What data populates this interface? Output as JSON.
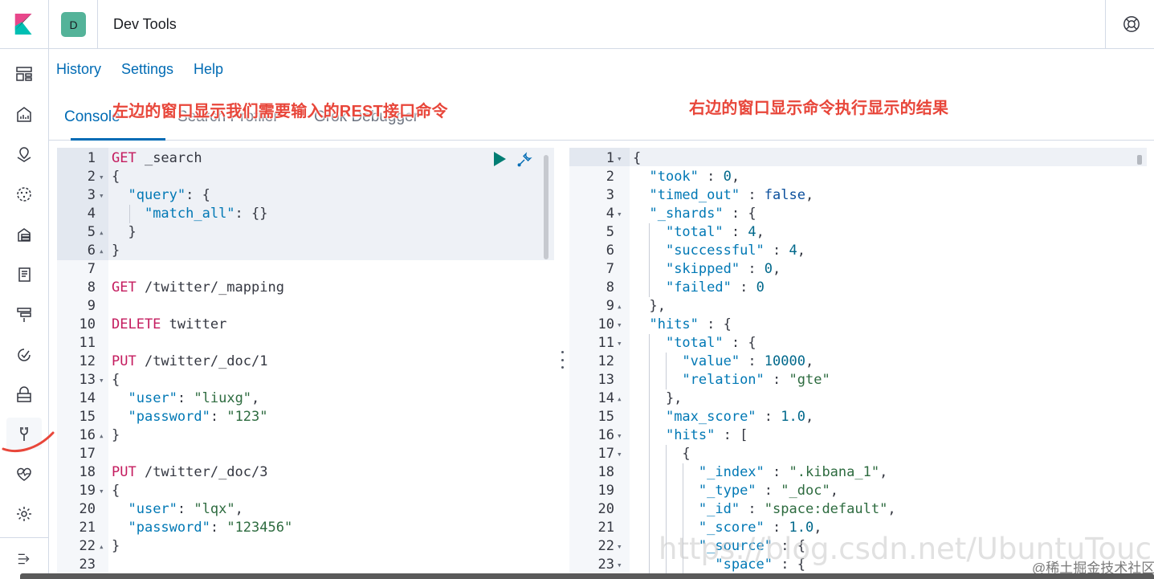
{
  "header": {
    "space_initial": "D",
    "app_title": "Dev Tools"
  },
  "leftnav": {
    "items": [
      {
        "icon": "discover-icon"
      },
      {
        "icon": "visualize-icon"
      },
      {
        "icon": "maps-icon"
      },
      {
        "icon": "ml-icon"
      },
      {
        "icon": "infrastructure-icon"
      },
      {
        "icon": "logs-icon"
      },
      {
        "icon": "apm-icon"
      },
      {
        "icon": "uptime-icon"
      },
      {
        "icon": "siem-icon"
      },
      {
        "icon": "dev-tools-icon",
        "active": true
      },
      {
        "icon": "monitoring-icon"
      },
      {
        "icon": "management-icon"
      }
    ],
    "collapse_icon": "collapse-menu-icon"
  },
  "topmenu": {
    "history": "History",
    "settings": "Settings",
    "help": "Help"
  },
  "tabs": {
    "console": "Console",
    "search_profiler": "Search Profiler",
    "grok_debugger": "Grok Debugger"
  },
  "annotations": {
    "left": "左边的窗口显示我们需要输入的REST接口命令",
    "right": "右边的窗口显示命令执行显示的结果"
  },
  "request_editor": {
    "lines": [
      {
        "n": "1",
        "fold": "",
        "tokens": [
          [
            "m",
            "GET"
          ],
          [
            "u",
            " _search"
          ]
        ]
      },
      {
        "n": "2",
        "fold": "▾",
        "tokens": [
          [
            "u",
            "{"
          ]
        ]
      },
      {
        "n": "3",
        "fold": "▾",
        "tokens": [
          [
            "u",
            "  "
          ],
          [
            "k",
            "\"query\""
          ],
          [
            "u",
            ": {"
          ]
        ]
      },
      {
        "n": "4",
        "fold": "",
        "tokens": [
          [
            "u",
            "    "
          ],
          [
            "k",
            "\"match_all\""
          ],
          [
            "u",
            ": {}"
          ]
        ]
      },
      {
        "n": "5",
        "fold": "▴",
        "tokens": [
          [
            "u",
            "  }"
          ]
        ]
      },
      {
        "n": "6",
        "fold": "▴",
        "tokens": [
          [
            "u",
            "}"
          ]
        ]
      },
      {
        "n": "7",
        "fold": "",
        "tokens": []
      },
      {
        "n": "8",
        "fold": "",
        "tokens": [
          [
            "m",
            "GET"
          ],
          [
            "u",
            " /twitter/_mapping"
          ]
        ]
      },
      {
        "n": "9",
        "fold": "",
        "tokens": []
      },
      {
        "n": "10",
        "fold": "",
        "tokens": [
          [
            "m",
            "DELETE"
          ],
          [
            "u",
            " twitter"
          ]
        ]
      },
      {
        "n": "11",
        "fold": "",
        "tokens": []
      },
      {
        "n": "12",
        "fold": "",
        "tokens": [
          [
            "m",
            "PUT"
          ],
          [
            "u",
            " /twitter/_doc/1"
          ]
        ]
      },
      {
        "n": "13",
        "fold": "▾",
        "tokens": [
          [
            "u",
            "{"
          ]
        ]
      },
      {
        "n": "14",
        "fold": "",
        "tokens": [
          [
            "u",
            "  "
          ],
          [
            "k",
            "\"user\""
          ],
          [
            "u",
            ": "
          ],
          [
            "s",
            "\"liuxg\""
          ],
          [
            "u",
            ","
          ]
        ]
      },
      {
        "n": "15",
        "fold": "",
        "tokens": [
          [
            "u",
            "  "
          ],
          [
            "k",
            "\"password\""
          ],
          [
            "u",
            ": "
          ],
          [
            "s",
            "\"123\""
          ]
        ]
      },
      {
        "n": "16",
        "fold": "▴",
        "tokens": [
          [
            "u",
            "}"
          ]
        ]
      },
      {
        "n": "17",
        "fold": "",
        "tokens": []
      },
      {
        "n": "18",
        "fold": "",
        "tokens": [
          [
            "m",
            "PUT"
          ],
          [
            "u",
            " /twitter/_doc/3"
          ]
        ]
      },
      {
        "n": "19",
        "fold": "▾",
        "tokens": [
          [
            "u",
            "{"
          ]
        ]
      },
      {
        "n": "20",
        "fold": "",
        "tokens": [
          [
            "u",
            "  "
          ],
          [
            "k",
            "\"user\""
          ],
          [
            "u",
            ": "
          ],
          [
            "s",
            "\"lqx\""
          ],
          [
            "u",
            ","
          ]
        ]
      },
      {
        "n": "21",
        "fold": "",
        "tokens": [
          [
            "u",
            "  "
          ],
          [
            "k",
            "\"password\""
          ],
          [
            "u",
            ": "
          ],
          [
            "s",
            "\"123456\""
          ]
        ]
      },
      {
        "n": "22",
        "fold": "▴",
        "tokens": [
          [
            "u",
            "}"
          ]
        ]
      },
      {
        "n": "23",
        "fold": "",
        "tokens": []
      }
    ]
  },
  "response_editor": {
    "lines": [
      {
        "n": "1",
        "fold": "▾",
        "tokens": [
          [
            "u",
            "{"
          ]
        ]
      },
      {
        "n": "2",
        "fold": "",
        "tokens": [
          [
            "u",
            "  "
          ],
          [
            "k",
            "\"took\""
          ],
          [
            "u",
            " : "
          ],
          [
            "i",
            "0"
          ],
          [
            "u",
            ","
          ]
        ]
      },
      {
        "n": "3",
        "fold": "",
        "tokens": [
          [
            "u",
            "  "
          ],
          [
            "k",
            "\"timed_out\""
          ],
          [
            "u",
            " : "
          ],
          [
            "b",
            "false"
          ],
          [
            "u",
            ","
          ]
        ]
      },
      {
        "n": "4",
        "fold": "▾",
        "tokens": [
          [
            "u",
            "  "
          ],
          [
            "k",
            "\"_shards\""
          ],
          [
            "u",
            " : {"
          ]
        ]
      },
      {
        "n": "5",
        "fold": "",
        "tokens": [
          [
            "u",
            "    "
          ],
          [
            "k",
            "\"total\""
          ],
          [
            "u",
            " : "
          ],
          [
            "i",
            "4"
          ],
          [
            "u",
            ","
          ]
        ]
      },
      {
        "n": "6",
        "fold": "",
        "tokens": [
          [
            "u",
            "    "
          ],
          [
            "k",
            "\"successful\""
          ],
          [
            "u",
            " : "
          ],
          [
            "i",
            "4"
          ],
          [
            "u",
            ","
          ]
        ]
      },
      {
        "n": "7",
        "fold": "",
        "tokens": [
          [
            "u",
            "    "
          ],
          [
            "k",
            "\"skipped\""
          ],
          [
            "u",
            " : "
          ],
          [
            "i",
            "0"
          ],
          [
            "u",
            ","
          ]
        ]
      },
      {
        "n": "8",
        "fold": "",
        "tokens": [
          [
            "u",
            "    "
          ],
          [
            "k",
            "\"failed\""
          ],
          [
            "u",
            " : "
          ],
          [
            "i",
            "0"
          ]
        ]
      },
      {
        "n": "9",
        "fold": "▴",
        "tokens": [
          [
            "u",
            "  },"
          ]
        ]
      },
      {
        "n": "10",
        "fold": "▾",
        "tokens": [
          [
            "u",
            "  "
          ],
          [
            "k",
            "\"hits\""
          ],
          [
            "u",
            " : {"
          ]
        ]
      },
      {
        "n": "11",
        "fold": "▾",
        "tokens": [
          [
            "u",
            "    "
          ],
          [
            "k",
            "\"total\""
          ],
          [
            "u",
            " : {"
          ]
        ]
      },
      {
        "n": "12",
        "fold": "",
        "tokens": [
          [
            "u",
            "      "
          ],
          [
            "k",
            "\"value\""
          ],
          [
            "u",
            " : "
          ],
          [
            "i",
            "10000"
          ],
          [
            "u",
            ","
          ]
        ]
      },
      {
        "n": "13",
        "fold": "",
        "tokens": [
          [
            "u",
            "      "
          ],
          [
            "k",
            "\"relation\""
          ],
          [
            "u",
            " : "
          ],
          [
            "s",
            "\"gte\""
          ]
        ]
      },
      {
        "n": "14",
        "fold": "▴",
        "tokens": [
          [
            "u",
            "    },"
          ]
        ]
      },
      {
        "n": "15",
        "fold": "",
        "tokens": [
          [
            "u",
            "    "
          ],
          [
            "k",
            "\"max_score\""
          ],
          [
            "u",
            " : "
          ],
          [
            "i",
            "1.0"
          ],
          [
            "u",
            ","
          ]
        ]
      },
      {
        "n": "16",
        "fold": "▾",
        "tokens": [
          [
            "u",
            "    "
          ],
          [
            "k",
            "\"hits\""
          ],
          [
            "u",
            " : ["
          ]
        ]
      },
      {
        "n": "17",
        "fold": "▾",
        "tokens": [
          [
            "u",
            "      {"
          ]
        ]
      },
      {
        "n": "18",
        "fold": "",
        "tokens": [
          [
            "u",
            "        "
          ],
          [
            "k",
            "\"_index\""
          ],
          [
            "u",
            " : "
          ],
          [
            "s",
            "\".kibana_1\""
          ],
          [
            "u",
            ","
          ]
        ]
      },
      {
        "n": "19",
        "fold": "",
        "tokens": [
          [
            "u",
            "        "
          ],
          [
            "k",
            "\"_type\""
          ],
          [
            "u",
            " : "
          ],
          [
            "s",
            "\"_doc\""
          ],
          [
            "u",
            ","
          ]
        ]
      },
      {
        "n": "20",
        "fold": "",
        "tokens": [
          [
            "u",
            "        "
          ],
          [
            "k",
            "\"_id\""
          ],
          [
            "u",
            " : "
          ],
          [
            "s",
            "\"space:default\""
          ],
          [
            "u",
            ","
          ]
        ]
      },
      {
        "n": "21",
        "fold": "",
        "tokens": [
          [
            "u",
            "        "
          ],
          [
            "k",
            "\"_score\""
          ],
          [
            "u",
            " : "
          ],
          [
            "i",
            "1.0"
          ],
          [
            "u",
            ","
          ]
        ]
      },
      {
        "n": "22",
        "fold": "▾",
        "tokens": [
          [
            "u",
            "        "
          ],
          [
            "k",
            "\"_source\""
          ],
          [
            "u",
            " : {"
          ]
        ]
      },
      {
        "n": "23",
        "fold": "▾",
        "tokens": [
          [
            "u",
            "          "
          ],
          [
            "k",
            "\"space\""
          ],
          [
            "u",
            " : {"
          ]
        ]
      }
    ]
  },
  "watermark": {
    "url": "https://blog.csdn.net/UbuntuTouch",
    "credit": "@稀土掘金技术社区"
  }
}
